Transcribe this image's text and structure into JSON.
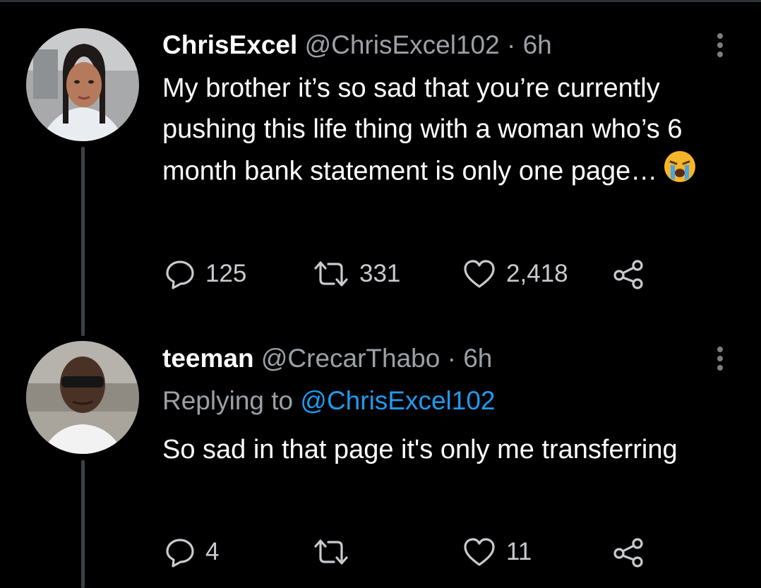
{
  "colors": {
    "background": "#000000",
    "text": "#ffffff",
    "secondary": "#9ba1a6",
    "link": "#1d9bf0",
    "thread_line": "#3d4043"
  },
  "tweets": [
    {
      "name": "ChrisExcel",
      "handle": "@ChrisExcel102",
      "separator": "·",
      "time": "6h",
      "text": "My brother it’s so sad that you’re currently pushing this life thing with a woman who’s 6 month bank statement is only one page…",
      "emoji": "loudly-crying-face-emoji",
      "replies": "125",
      "retweets": "331",
      "likes": "2,418"
    },
    {
      "name": "teeman",
      "handle": "@CrecarThabo",
      "separator": "·",
      "time": "6h",
      "replying_prefix": "Replying to",
      "replying_to": "@ChrisExcel102",
      "text": "So sad in that page it's only me transferring",
      "replies": "4",
      "retweets": "",
      "likes": "11"
    }
  ]
}
